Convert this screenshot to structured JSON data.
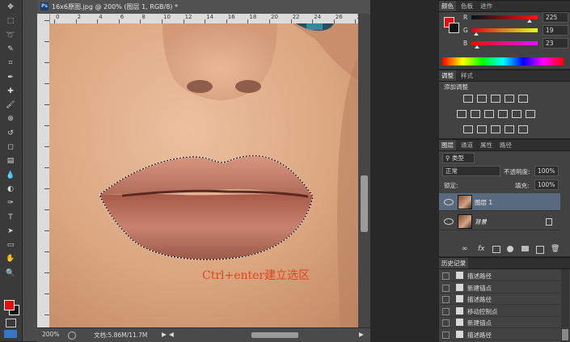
{
  "document": {
    "title": "16x6原图.jpg @ 200% (图层 1, RGB/8) *",
    "ruler_ticks": [
      "0",
      "2",
      "4",
      "6",
      "8",
      "10",
      "12",
      "14",
      "16",
      "18",
      "20",
      "22",
      "24",
      "26",
      "27"
    ],
    "caption": "Ctrl+enter建立选区",
    "zoom": "200%",
    "doc_size": "文档:5.86M/11.7M"
  },
  "toolbar": {
    "tools": [
      "move-tool",
      "marquee-tool",
      "lasso-tool",
      "quick-select-tool",
      "crop-tool",
      "eyedropper-tool",
      "healing-brush-tool",
      "brush-tool",
      "clone-stamp-tool",
      "history-brush-tool",
      "eraser-tool",
      "gradient-tool",
      "blur-tool",
      "dodge-tool",
      "pen-tool",
      "type-tool",
      "path-select-tool",
      "shape-tool",
      "hand-tool",
      "zoom-tool"
    ],
    "foreground_color": "#e01010",
    "background_color": "#111111"
  },
  "color_panel": {
    "tabs": [
      "颜色",
      "色板",
      "进作"
    ],
    "channels": [
      {
        "label": "R",
        "value": "225"
      },
      {
        "label": "G",
        "value": "19"
      },
      {
        "label": "B",
        "value": "23"
      }
    ]
  },
  "adjustments_panel": {
    "tabs": [
      "调整",
      "样式"
    ],
    "heading": "添加调整"
  },
  "layers_panel": {
    "tabs": [
      "图层",
      "通道",
      "属性",
      "路径"
    ],
    "filter_kind": "类型",
    "blend_mode": "正常",
    "opacity_label": "不透明度:",
    "opacity_value": "100%",
    "lock_label": "锁定:",
    "fill_label": "填充:",
    "fill_value": "100%",
    "layers": [
      {
        "name": "图层 1",
        "selected": true
      },
      {
        "name": "背景",
        "selected": false
      }
    ]
  },
  "history_panel": {
    "tab": "历史记录",
    "items": [
      "描述路径",
      "新建锚点",
      "描述路径",
      "移动控制点",
      "新建锚点",
      "描述路径"
    ]
  },
  "colors": {
    "accent_blue": "#2c6db5",
    "selected_layer": "#5a6a7e"
  }
}
